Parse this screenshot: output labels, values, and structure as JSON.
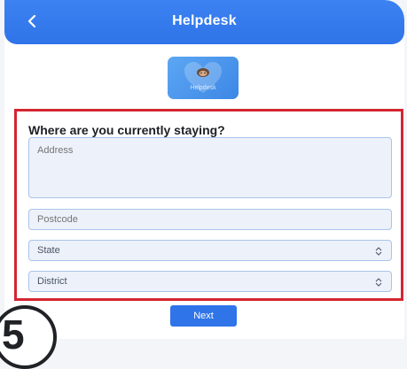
{
  "header": {
    "title": "Helpdesk",
    "back_icon": "chevron-left-icon"
  },
  "logo": {
    "text": "Helpdesk"
  },
  "form": {
    "question": "Where are you currently staying?",
    "address_placeholder": "Address",
    "postcode_placeholder": "Postcode",
    "state_label": "State",
    "district_label": "District"
  },
  "actions": {
    "next_label": "Next"
  },
  "step": {
    "number": "5"
  },
  "colors": {
    "brand": "#2f74e8",
    "highlight_border": "#d42532",
    "field_bg": "#edf1fa"
  }
}
